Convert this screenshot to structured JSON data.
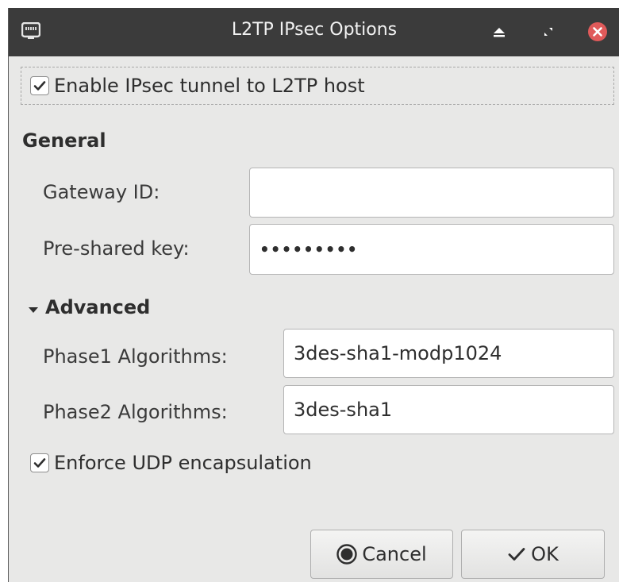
{
  "window": {
    "title": "L2TP IPsec Options",
    "icons": {
      "app": "network-icon",
      "shade": "eject-up-icon",
      "restore": "restore-icon",
      "close": "close-icon"
    },
    "titlebar_color": "#3b3b3b",
    "close_color": "#e05a5a"
  },
  "enable_ipsec": {
    "label": "Enable IPsec tunnel to L2TP host",
    "checked": true
  },
  "general": {
    "title": "General",
    "gateway_id": {
      "label": "Gateway ID:",
      "value": ""
    },
    "pre_shared_key": {
      "label": "Pre-shared key:",
      "value": "•••••••••"
    }
  },
  "advanced": {
    "title": "Advanced",
    "expanded": true,
    "phase1": {
      "label": "Phase1 Algorithms:",
      "value": "3des-sha1-modp1024"
    },
    "phase2": {
      "label": "Phase2 Algorithms:",
      "value": "3des-sha1"
    },
    "enforce_udp": {
      "label": "Enforce UDP encapsulation",
      "checked": true
    }
  },
  "buttons": {
    "cancel": {
      "label": "Cancel",
      "icon": "cancel-icon"
    },
    "ok": {
      "label": "OK",
      "icon": "checkmark-icon"
    }
  }
}
